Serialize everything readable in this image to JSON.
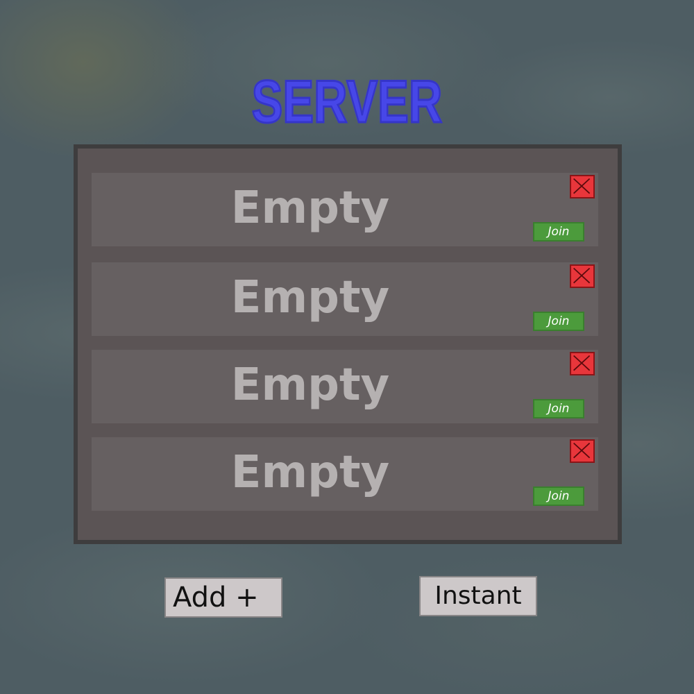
{
  "title": "SERVER",
  "servers": [
    {
      "label": "Empty",
      "join_label": "Join"
    },
    {
      "label": "Empty",
      "join_label": "Join"
    },
    {
      "label": "Empty",
      "join_label": "Join"
    },
    {
      "label": "Empty",
      "join_label": "Join"
    }
  ],
  "buttons": {
    "add_label": "Add +",
    "instant_label": "Instant"
  },
  "colors": {
    "title": "#4747e8",
    "delete": "#e8363b",
    "join": "#4c9b3c"
  },
  "icons": {
    "delete": "close-icon"
  }
}
